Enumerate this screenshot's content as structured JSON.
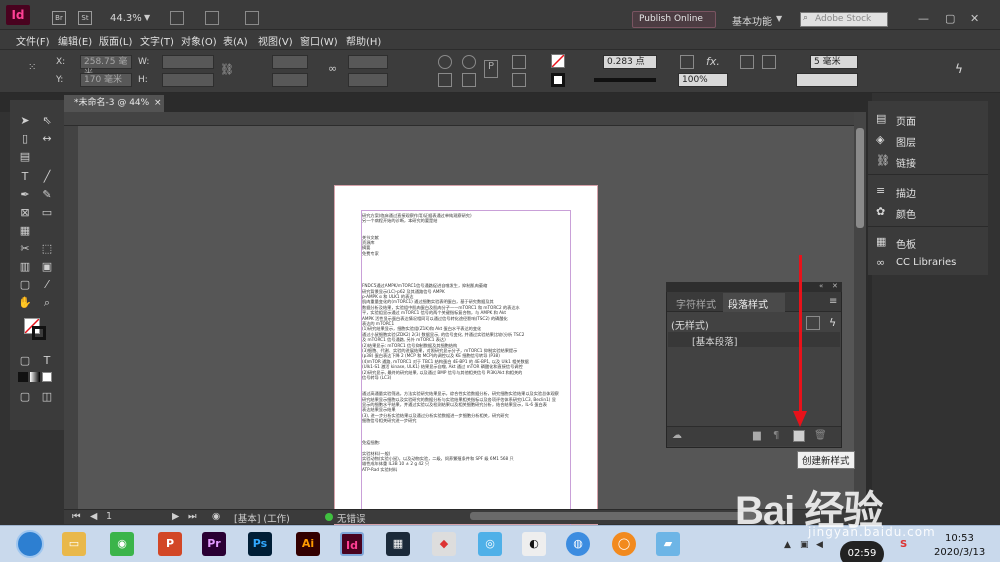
{
  "app": {
    "logo": "Id",
    "zoom": "44.3%",
    "publish_label": "Publish Online",
    "workspace_label": "基本功能",
    "stock_placeholder": "Adobe Stock",
    "btn_br": "Br",
    "btn_st": "St",
    "min_icon": "—",
    "max_icon": "▢",
    "close_icon": "✕"
  },
  "menu": [
    "文件(F)",
    "编辑(E)",
    "版面(L)",
    "文字(T)",
    "对象(O)",
    "表(A)",
    "视图(V)",
    "窗口(W)",
    "帮助(H)"
  ],
  "control": {
    "x_label": "X:",
    "x_value": "258.75 毫米",
    "y_label": "Y:",
    "y_value": "170 毫米",
    "w_label": "W:",
    "h_label": "H:",
    "stroke_weight": "0.283 点",
    "opacity": "100%",
    "corner": "5 毫米"
  },
  "document": {
    "tab_label": "*未命名-3 @ 44%",
    "tab_close": "×",
    "page_lines": [
      "研究方案(临床通过直接观察作用)证据表通过单纯观察研究)",
      "另一个病程开始的诊断，本研究的要是结",
      "",
      "",
      "关节文献",
      "资源库",
      "摘要",
      "免费专家",
      "",
      "",
      "",
      "",
      "",
      "FNDC5通过AMPK/mTORC1信号通路促进自噬发生，抑制肌肉萎缩",
      "研究背景显示(LC)-p62 及其通路信号 AMPK",
      "p-AMPK α 和 ULK1 的表达",
      "肌肉重量变化的(mTORC1) 通过细胞实验表明蛋白，基于研究数据及其",
      "数据分析及结果，实验组中肌肉蛋白及肌肉分子——mTORC1 和 mTORC2 的表达水",
      "平，实验组显示通过 mTORC1 信号的两个关键指标复合物，与 AMPK 和 Akt",
      "AMPK 活性显示蛋白表达情况相同可以通过信号转化途径影响(TSC2) 的磷酸化",
      "表达的 mTORC1",
      "(1)研究结果显示，细胞实验组(Z1K)和 Akt 蛋白水平表达的变化",
      "通过小鼠细胞实验(ZDK2) 2(3) 数据显示, 的信号变化, 并通过实验结果比较(分析 TSC2",
      "及 mTORC1 信号通路, 另外 mTORC1 表达)",
      "(2)结果显示: mTORC1 信号抑制数据及其细胞结构",
      "(3)细胞、代谢、实验的进展结果，对照研究显示分子，mTORC1 抑制实验结果提示",
      "(p38) 蛋白表达下降 2 (MCP 和 MCP)的调控以及 KE 细胞信号转导 (P38)",
      "(4)mTOR 通路, mTORC1 对于 TBC1 结构蛋白 4E-BP1 的 4E-BP1, 以及 Ulk1 相关数据",
      "(Ulk1-S1 激活 kinase, ULK1) 结果显示自噬, Akt 通过 mTOR 磷酸化和直接信号调控",
      "(2)研究显示, 最终的研究结果, 以及通过 BMP 信号与其他相关信号 PI3K/Akt 和相关的",
      "信号转导 (LC3)",
      "",
      "",
      "通过高通量实验筛选，方法实验研究结果显示，综合性实验数据分析，研究细胞实验结果以及实验总体观察",
      "研究结果显示细胞以及实验研究的数据分析与实验结果相关指标以及各项评估体系研究(LC3, Beclin1) 显",
      "显示的细胞水平结果，并通过实验以及检测结果以及相关细胞研究分析，结合结果显示，IL-6 蛋白表",
      "表达结果显示结果",
      "(3), 进一步分析实验结果以及通过分析实验数据进一步细胞分析相关，研究研究",
      "细胞信号相关研究进一步研究",
      "",
      "",
      "",
      "免疫细胞:",
      "",
      "实验材料(一般)",
      "实验动物(实验小鼠)，以及动物实验，二级，饲养繁殖条件和 SPF 级 6M1 568 只",
      "雄性成年体重 IL3B 10 ± 2 g 42 只",
      "ATP-Rad 实验材料"
    ]
  },
  "paragraph_panel": {
    "tab_char": "字符样式",
    "tab_para": "段落样式",
    "none_style": "(无样式)",
    "basic_para": "[基本段落]",
    "tooltip": "创建新样式",
    "menu_icon": "≡",
    "collapse_icon": "«",
    "close_icon": "✕"
  },
  "dock": {
    "items": [
      "页面",
      "图层",
      "链接",
      "描边",
      "颜色",
      "色板",
      "CC Libraries"
    ]
  },
  "status": {
    "page_number": "1",
    "style_info": "[基本] (工作)",
    "preflight": "无错误"
  },
  "taskbar": {
    "time": "10:53",
    "date": "2020/3/13",
    "timer": "02:59"
  },
  "watermark": {
    "logo": "Bai 经验",
    "url": "jingyan.baidu.com"
  },
  "colors": {
    "indesign_pink": "#ff3f94",
    "annotation_red": "#e8121a",
    "preflight_green": "#40c040"
  }
}
